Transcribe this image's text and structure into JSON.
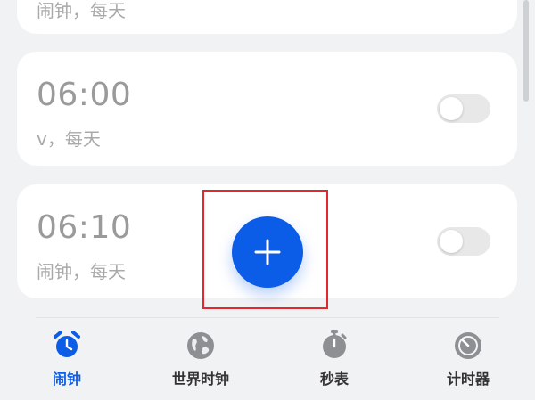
{
  "alarms": [
    {
      "time": "",
      "label": "闹钟，每天",
      "enabled": false
    },
    {
      "time": "06:00",
      "label": "v，每天",
      "enabled": false
    },
    {
      "time": "06:10",
      "label": "闹钟，每天",
      "enabled": false
    }
  ],
  "fab": {
    "icon": "plus-icon",
    "color": "#0b5ce6"
  },
  "tabs": [
    {
      "label": "闹钟",
      "icon": "alarm-clock-icon",
      "active": true
    },
    {
      "label": "世界时钟",
      "icon": "globe-icon",
      "active": false
    },
    {
      "label": "秒表",
      "icon": "stopwatch-icon",
      "active": false
    },
    {
      "label": "计时器",
      "icon": "timer-icon",
      "active": false
    }
  ],
  "colors": {
    "accent": "#0b5ce6",
    "highlight": "#e0282d",
    "inactive_icon": "#8e8f93"
  }
}
